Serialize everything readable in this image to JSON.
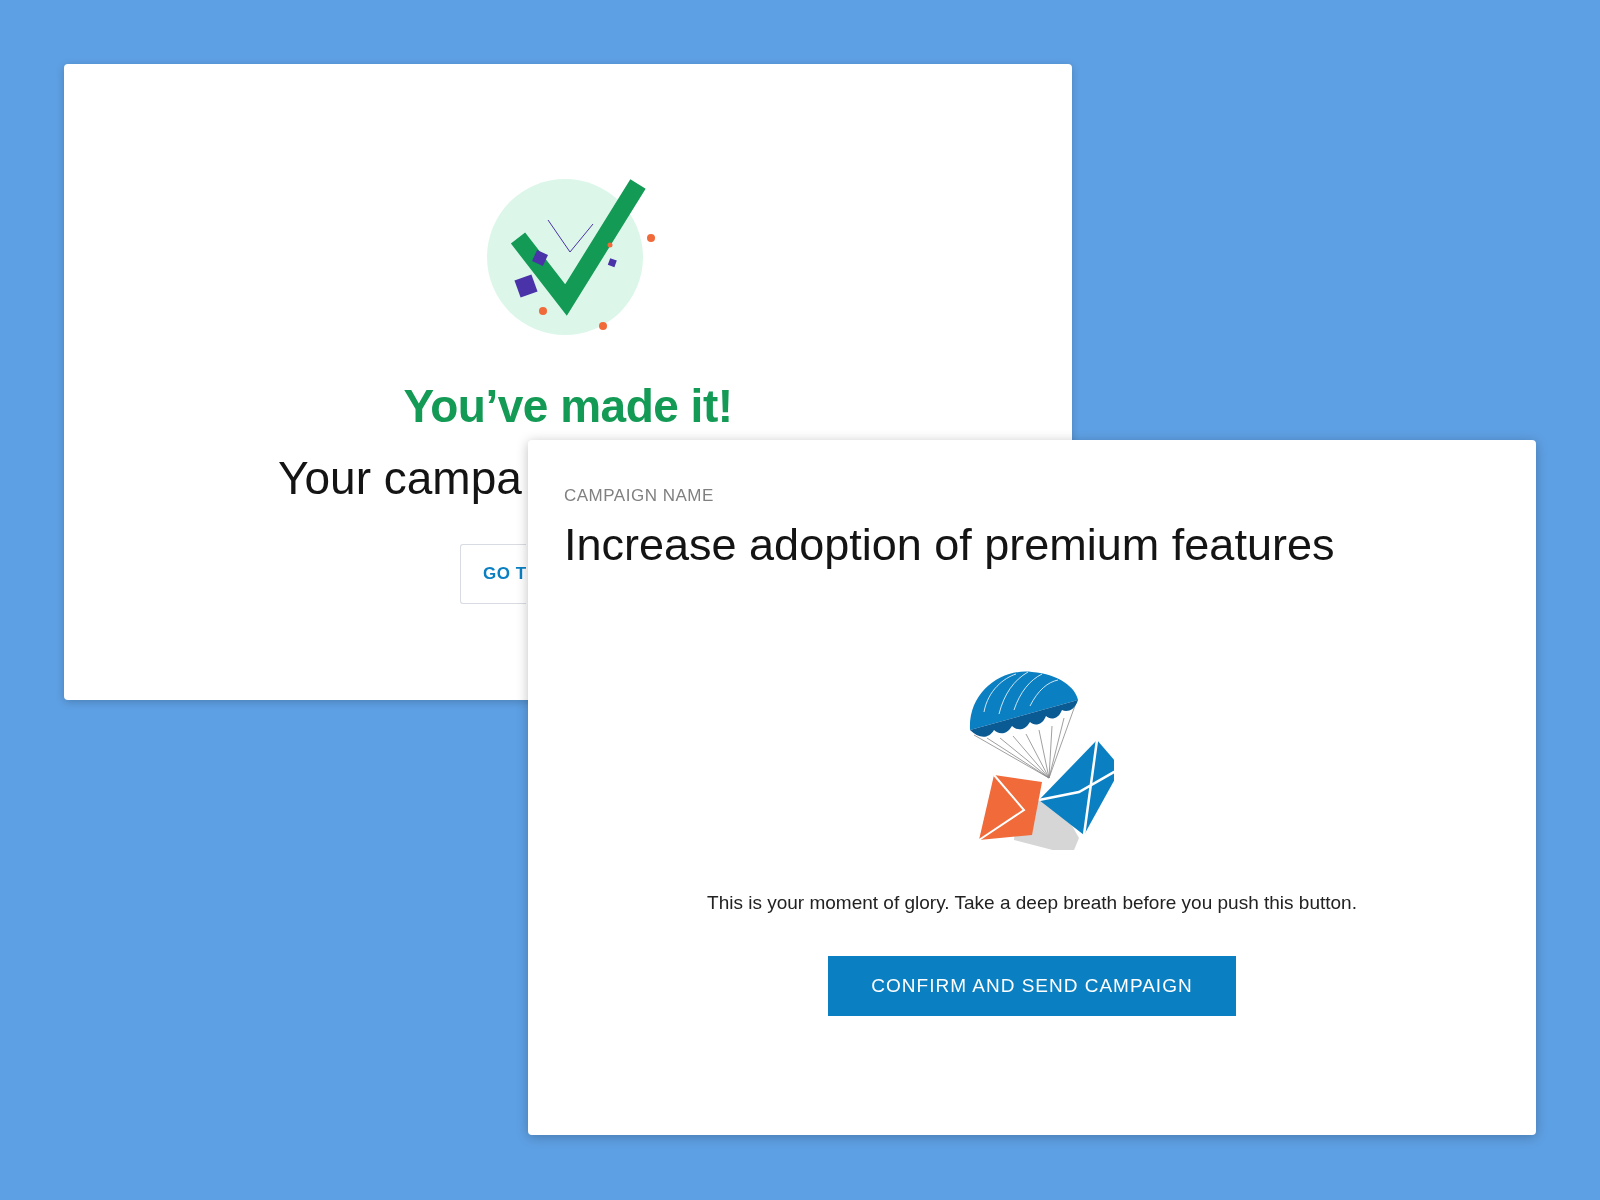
{
  "success_card": {
    "title": "You’ve made it!",
    "subtitle": "Your campa",
    "button": "GO T"
  },
  "confirm_card": {
    "label": "CAMPAIGN NAME",
    "heading": "Increase adoption of premium features",
    "message": "This is your moment of glory. Take a deep breath before you push this button.",
    "button": "CONFIRM AND SEND CAMPAIGN"
  }
}
